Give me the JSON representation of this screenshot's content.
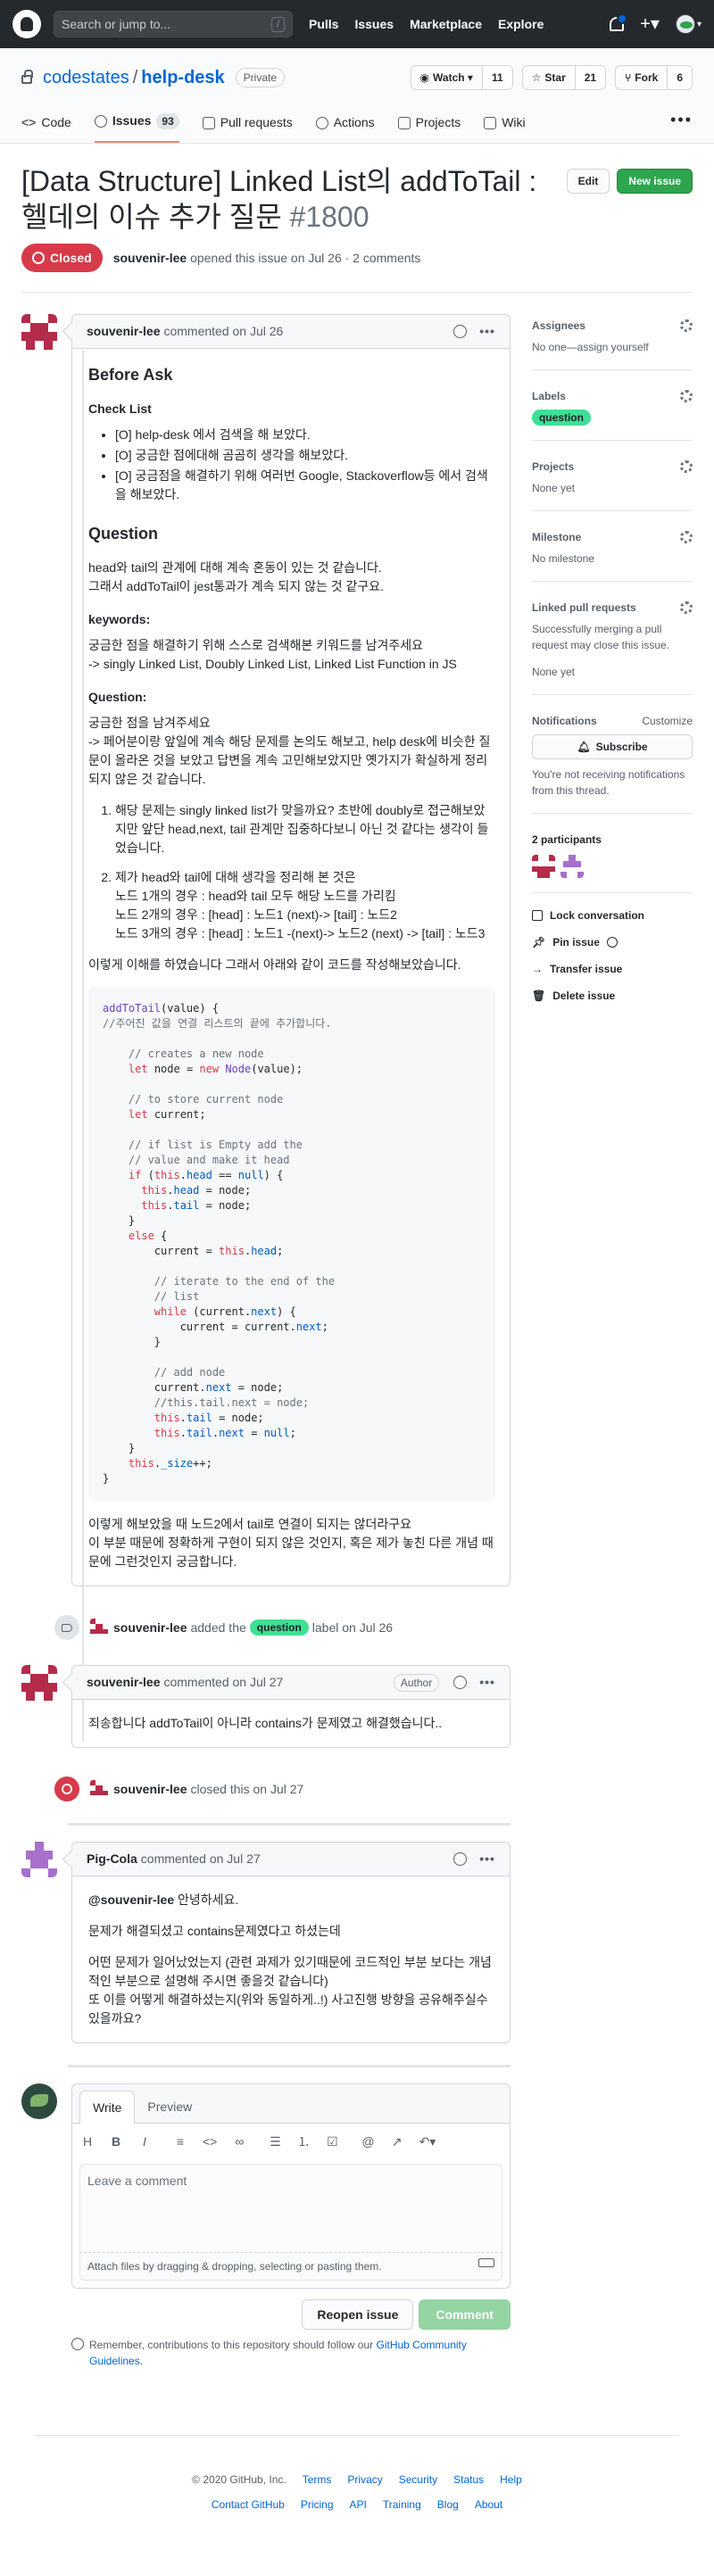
{
  "header": {
    "search_placeholder": "Search or jump to...",
    "slash_key": "/",
    "nav": [
      "Pulls",
      "Issues",
      "Marketplace",
      "Explore"
    ]
  },
  "repo": {
    "owner": "codestates",
    "separator": "/",
    "name": "help-desk",
    "visibility": "Private",
    "watch_label": "Watch",
    "watch_count": "11",
    "star_label": "Star",
    "star_count": "21",
    "fork_label": "Fork",
    "fork_count": "6",
    "tabs": [
      {
        "label": "Code"
      },
      {
        "label": "Issues",
        "count": "93"
      },
      {
        "label": "Pull requests"
      },
      {
        "label": "Actions"
      },
      {
        "label": "Projects"
      },
      {
        "label": "Wiki"
      }
    ]
  },
  "issue": {
    "title": "[Data Structure] Linked List의 addToTail : 헬데의 이슈 추가 질문",
    "number": "#1800",
    "edit_label": "Edit",
    "new_issue_label": "New issue",
    "state": "Closed",
    "author": "souvenir-lee",
    "meta_text": "opened this issue on Jul 26 · 2 comments"
  },
  "comment1": {
    "author": "souvenir-lee",
    "time": "commented on Jul 26",
    "before_ask": "Before Ask",
    "checklist_heading": "Check List",
    "checklist": [
      "[O] help-desk 에서 검색을 해 보았다.",
      "[O] 궁금한 점에대해 곰곰히 생각을 해보았다.",
      "[O] 궁금점을 해결하기 위해 여러번 Google, Stackoverflow등 에서 검색을 해보았다."
    ],
    "question_heading": "Question",
    "question_p1a": "head와 tail의 관계에 대해 계속 혼동이 있는 것 같습니다.",
    "question_p1b": "그래서 addToTail이 jest통과가 계속 되지 않는 것 같구요.",
    "keywords_heading": "keywords:",
    "keywords_p1": "궁금한 점을 해결하기 위해 스스로 검색해본 키워드를 남겨주세요",
    "keywords_p2": "-> singly Linked List, Doubly Linked List, Linked List Function in JS",
    "question2_heading": "Question:",
    "question2_p1": "궁금한 점을 남겨주세요",
    "question2_p2": "-> 페어분이랑 앞일에 계속 해당 문제를 논의도 해보고, help desk에 비슷한 질문이 올라온 것을 보았고 답변을 계속 고민해보았지만 옛가지가 확실하게 정리되지 않은 것 같습니다.",
    "ol_item1": "해당 문제는 singly linked list가 맞을까요? 초반에 doubly로 접근해보았지만 앞단 head,next, tail 관계만 집중하다보니 아닌 것 같다는 생각이 들었습니다.",
    "ol_item2_lead": "제가 head와 tail에 대해 생각을 정리해 본 것은",
    "ol_item2_lines": [
      "노드 1개의 경우 : head와 tail 모두 해당 노드를 가리킴",
      "노드 2개의 경우 : [head] : 노드1 (next)-> [tail] : 노드2",
      "노드 3개의 경우 : [head] : 노드1 -(next)-> 노드2 (next) -> [tail] : 노드3"
    ],
    "code_intro": "이렇게 이해를 하였습니다 그래서 아래와 같이 코드를 작성해보았습니다.",
    "outro_1": "이렇게 해보았을 때 노드2에서 tail로 연결이 되지는 않더라구요",
    "outro_2": "이 부분 때문에 정확하게 구현이 되지 않은 것인지, 혹은 제가 놓친 다른 개념 때문에 그런것인지 궁금합니다."
  },
  "event_label": {
    "actor": "souvenir-lee",
    "pre": "added the",
    "label": "question",
    "post": "label on Jul 26"
  },
  "comment2": {
    "author": "souvenir-lee",
    "time": "commented on Jul 27",
    "badge": "Author",
    "body": "죄송합니다 addToTail이 아니라 contains가 문제였고 해결했습니다.."
  },
  "event_closed": {
    "actor": "souvenir-lee",
    "text": "closed this on Jul 27"
  },
  "comment3": {
    "author": "Pig-Cola",
    "time": "commented on Jul 27",
    "mention": "@souvenir-lee",
    "greeting": " 안녕하세요.",
    "p2": "문제가 해결되셨고 contains문제였다고 하셨는데",
    "p3a": "어떤 문제가 일어났었는지 (관련 과제가 있기때문에 코드적인 부분 보다는 개념적인 부분으로 설명해 주시면 좋을것 같습니다)",
    "p3b": "또 이를 어떻게 해결하셨는지(위와 동일하게..!) 사고진행 방향을 공유해주실수 있을까요?"
  },
  "form": {
    "write_tab": "Write",
    "preview_tab": "Preview",
    "placeholder": "Leave a comment",
    "attach_text": "Attach files by dragging & dropping, selecting or pasting them.",
    "reopen_label": "Reopen issue",
    "comment_label": "Comment",
    "note_text": "Remember, contributions to this repository should follow our",
    "note_link": "GitHub Community Guidelines",
    "note_end": "."
  },
  "sidebar": {
    "assignees_heading": "Assignees",
    "assignees_text": "No one—assign yourself",
    "labels_heading": "Labels",
    "label": "question",
    "projects_heading": "Projects",
    "projects_text": "None yet",
    "milestone_heading": "Milestone",
    "milestone_text": "No milestone",
    "linked_heading": "Linked pull requests",
    "linked_text": "Successfully merging a pull request may close this issue.",
    "linked_none": "None yet",
    "notifications_heading": "Notifications",
    "customize": "Customize",
    "subscribe_label": "Subscribe",
    "notifications_text": "You're not receiving notifications from this thread.",
    "participants_heading": "2 participants",
    "lock": "Lock conversation",
    "pin": "Pin issue",
    "transfer": "Transfer issue",
    "delete": "Delete issue"
  },
  "footer": {
    "copyright": "© 2020 GitHub, Inc.",
    "row1": [
      "Terms",
      "Privacy",
      "Security",
      "Status",
      "Help"
    ],
    "row2": [
      "Contact GitHub",
      "Pricing",
      "API",
      "Training",
      "Blog",
      "About"
    ]
  },
  "colors": {
    "closed": "#d73a49",
    "label_question": "#3ee094",
    "accent": "#0366d6",
    "green_button": "#2ea44f"
  }
}
